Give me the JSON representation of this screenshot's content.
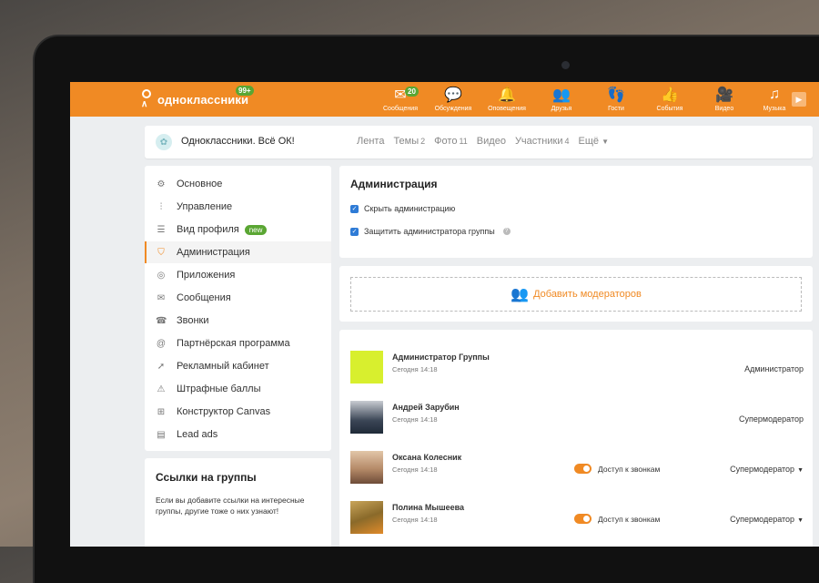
{
  "colors": {
    "accent": "#f08a24",
    "badge": "#5aa633",
    "check": "#2e7bd6"
  },
  "topbar": {
    "logo": "одноклассники",
    "logo_badge": "99+",
    "nav": [
      {
        "label": "Сообщения",
        "icon": "envelope-icon",
        "badge": "20"
      },
      {
        "label": "Обсуждения",
        "icon": "chat-bubbles-icon",
        "badge": ""
      },
      {
        "label": "Оповещения",
        "icon": "bell-icon",
        "badge": ""
      },
      {
        "label": "Друзья",
        "icon": "friends-icon",
        "badge": ""
      },
      {
        "label": "Гости",
        "icon": "footprints-icon",
        "badge": ""
      },
      {
        "label": "События",
        "icon": "events-icon",
        "badge": ""
      },
      {
        "label": "Видео",
        "icon": "video-camera-icon",
        "badge": ""
      },
      {
        "label": "Музыка",
        "icon": "music-note-icon",
        "badge": ""
      }
    ]
  },
  "group": {
    "name": "Одноклассники. Всё ОК!",
    "tabs": [
      {
        "label": "Лента",
        "count": ""
      },
      {
        "label": "Темы",
        "count": "2"
      },
      {
        "label": "Фото",
        "count": "11"
      },
      {
        "label": "Видео",
        "count": ""
      },
      {
        "label": "Участники",
        "count": "4"
      },
      {
        "label": "Ещё",
        "count": ""
      }
    ]
  },
  "sidebar": {
    "items": [
      {
        "label": "Основное",
        "icon": "gear-icon"
      },
      {
        "label": "Управление",
        "icon": "sliders-icon"
      },
      {
        "label": "Вид профиля",
        "icon": "layout-icon",
        "badge": "new"
      },
      {
        "label": "Администрация",
        "icon": "shield-icon",
        "active": true
      },
      {
        "label": "Приложения",
        "icon": "gamepad-icon"
      },
      {
        "label": "Сообщения",
        "icon": "envelope-icon"
      },
      {
        "label": "Звонки",
        "icon": "phone-icon"
      },
      {
        "label": "Партнёрская программа",
        "icon": "at-icon"
      },
      {
        "label": "Рекламный кабинет",
        "icon": "megaphone-icon"
      },
      {
        "label": "Штрафные баллы",
        "icon": "penalty-icon"
      },
      {
        "label": "Конструктор Canvas",
        "icon": "canvas-icon"
      },
      {
        "label": "Lead ads",
        "icon": "list-icon"
      }
    ]
  },
  "links": {
    "title": "Ссылки на группы",
    "text": "Если вы добавите ссылки на интересные группы, другие тоже о них узнают!"
  },
  "admin": {
    "title": "Администрация",
    "hide_admin": "Скрыть администрацию",
    "protect_admin": "Защитить администратора группы",
    "add_moderators": "Добавить модераторов"
  },
  "members": [
    {
      "name": "Администратор Группы",
      "time": "Сегодня 14:18",
      "role": "Администратор",
      "calls": "",
      "dropdown": false,
      "avatar": "#d8ef2e"
    },
    {
      "name": "Андрей Зарубин",
      "time": "Сегодня 14:18",
      "role": "Супермодератор",
      "calls": "",
      "dropdown": false,
      "avatar": "#2d3e52"
    },
    {
      "name": "Оксана Колесник",
      "time": "Сегодня 14:18",
      "role": "Супермодератор",
      "calls": "Доступ к звонкам",
      "dropdown": true,
      "avatar": "#a07a60"
    },
    {
      "name": "Полина Мышеева",
      "time": "Сегодня 14:18",
      "role": "Супермодератор",
      "calls": "Доступ к звонкам",
      "dropdown": true,
      "avatar": "#8a6a2a"
    }
  ]
}
